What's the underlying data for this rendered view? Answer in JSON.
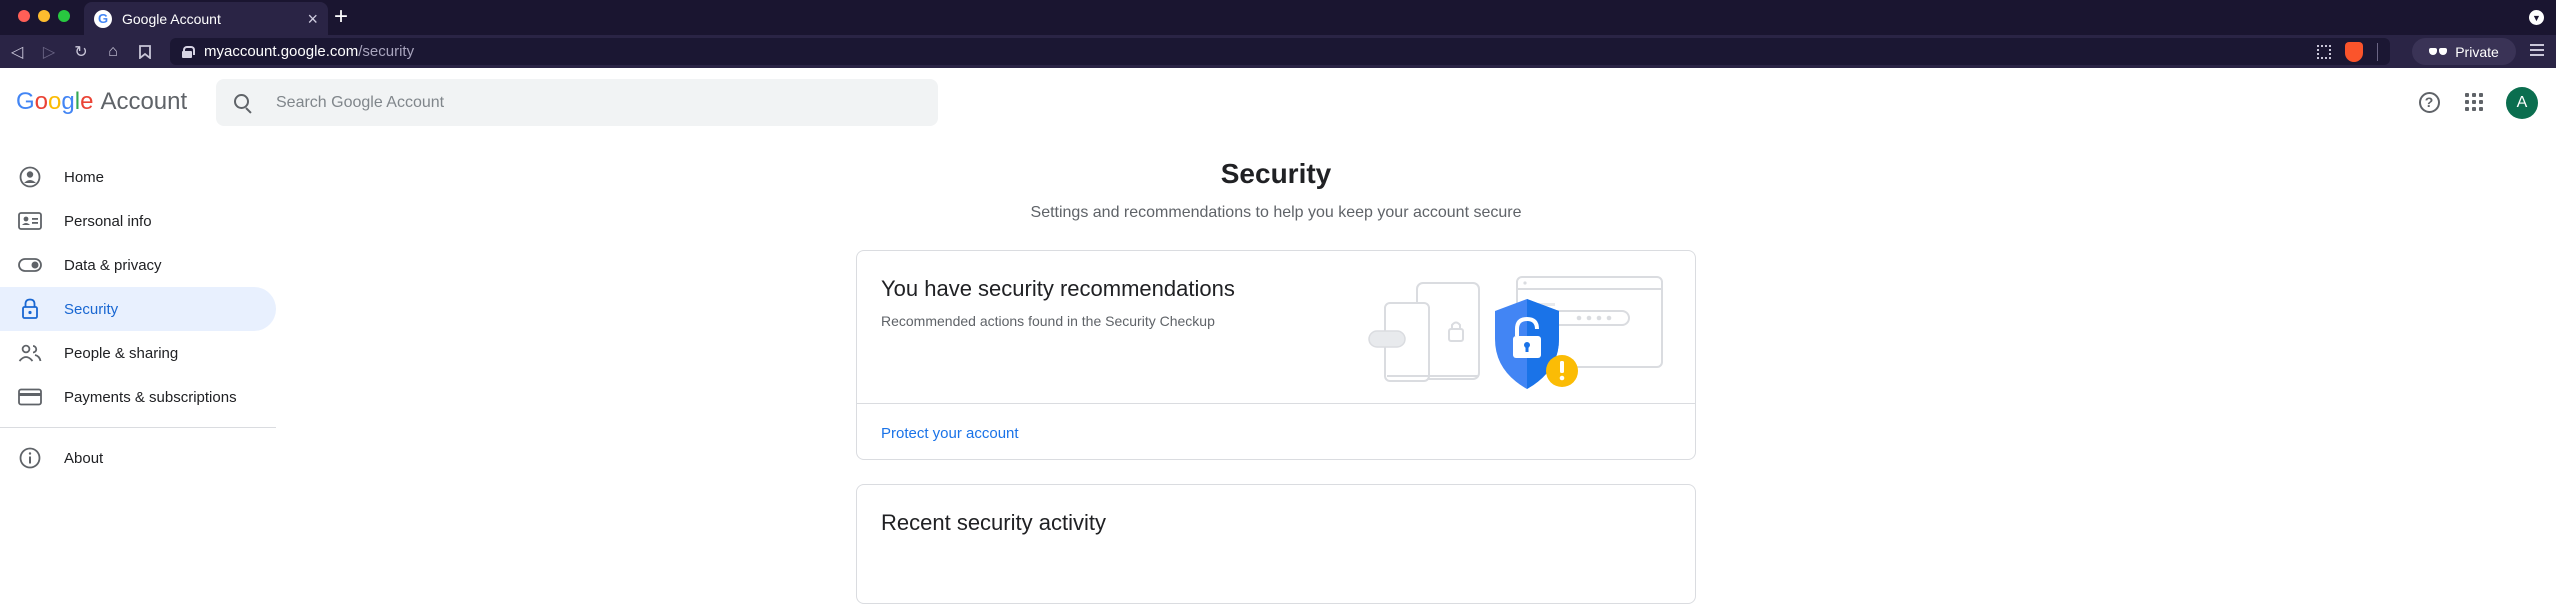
{
  "browser": {
    "tab_title": "Google Account",
    "url_host": "myaccount.google.com",
    "url_path": "/security",
    "private_label": "Private"
  },
  "header": {
    "brand_letters": [
      "G",
      "o",
      "o",
      "g",
      "l",
      "e"
    ],
    "brand_suffix": "Account",
    "search_placeholder": "Search Google Account",
    "avatar_letter": "A"
  },
  "sidebar": {
    "items": [
      {
        "label": "Home",
        "icon": "home-account-icon"
      },
      {
        "label": "Personal info",
        "icon": "id-card-icon"
      },
      {
        "label": "Data & privacy",
        "icon": "toggle-icon"
      },
      {
        "label": "Security",
        "icon": "lock-icon",
        "active": true
      },
      {
        "label": "People & sharing",
        "icon": "people-icon"
      },
      {
        "label": "Payments & subscriptions",
        "icon": "credit-card-icon"
      }
    ],
    "about_label": "About"
  },
  "main": {
    "title": "Security",
    "subtitle": "Settings and recommendations to help you keep your account secure",
    "recommendations": {
      "title": "You have security recommendations",
      "description": "Recommended actions found in the Security Checkup",
      "link": "Protect your account"
    },
    "recent_activity": {
      "title": "Recent security activity"
    }
  },
  "colors": {
    "accent": "#1a73e8",
    "active_nav_bg": "#e8f0fe",
    "shield": "#4285f4",
    "warning": "#fbbc05"
  }
}
